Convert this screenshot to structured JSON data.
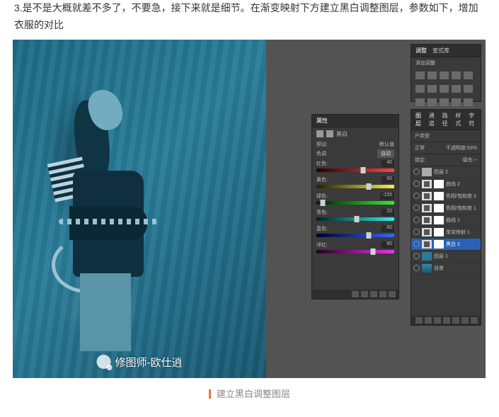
{
  "step_text": "3.是不是大概就差不多了，不要急，接下来就是细节。在渐变映射下方建立黑白调整图层，参数如下，增加衣服的对比",
  "watermark": "修图师-欧仕逍",
  "caption": "建立黑白调整图层",
  "adjustments": {
    "tab1": "调整",
    "tab2": "变式库",
    "subtitle": "添加调整"
  },
  "properties": {
    "tab": "属性",
    "type": "黑白",
    "preset_label": "预设:",
    "preset": "默认值",
    "tint_label": "色调",
    "auto": "自动",
    "sliders": [
      {
        "name": "红色:",
        "val": "40",
        "pos": 60,
        "cls": "t-red"
      },
      {
        "name": "黄色:",
        "val": "60",
        "pos": 67,
        "cls": "t-yellow"
      },
      {
        "name": "绿色:",
        "val": "-155",
        "pos": 8,
        "cls": "t-green"
      },
      {
        "name": "青色:",
        "val": "20",
        "pos": 52,
        "cls": "t-cyan"
      },
      {
        "name": "蓝色:",
        "val": "60",
        "pos": 67,
        "cls": "t-blue"
      },
      {
        "name": "洋红:",
        "val": "80",
        "pos": 73,
        "cls": "t-magenta"
      }
    ]
  },
  "layers": {
    "tabs": [
      "图层",
      "通道",
      "路径",
      "样式",
      "字符"
    ],
    "kind": "户类型",
    "blend": "正常",
    "opacity_label": "不透明度:",
    "opacity": "63%",
    "lock": "锁定:",
    "fill_label": "填充:",
    "fill": "--",
    "items": [
      {
        "name": "图层 2",
        "type": "pix",
        "cls": "thumb-sq"
      },
      {
        "name": "曲线 2",
        "type": "adj"
      },
      {
        "name": "色相/饱和度 3",
        "type": "adj"
      },
      {
        "name": "色相/饱和度 1",
        "type": "adj"
      },
      {
        "name": "曲线 1",
        "type": "adj"
      },
      {
        "name": "渐变映射 1",
        "type": "adj"
      },
      {
        "name": "黑白 1",
        "type": "adj",
        "sel": true
      },
      {
        "name": "图层 1",
        "type": "pix",
        "cls": "thumb-blue"
      },
      {
        "name": "背景",
        "type": "pix",
        "cls": "thumb-grad",
        "lock": true
      }
    ]
  }
}
